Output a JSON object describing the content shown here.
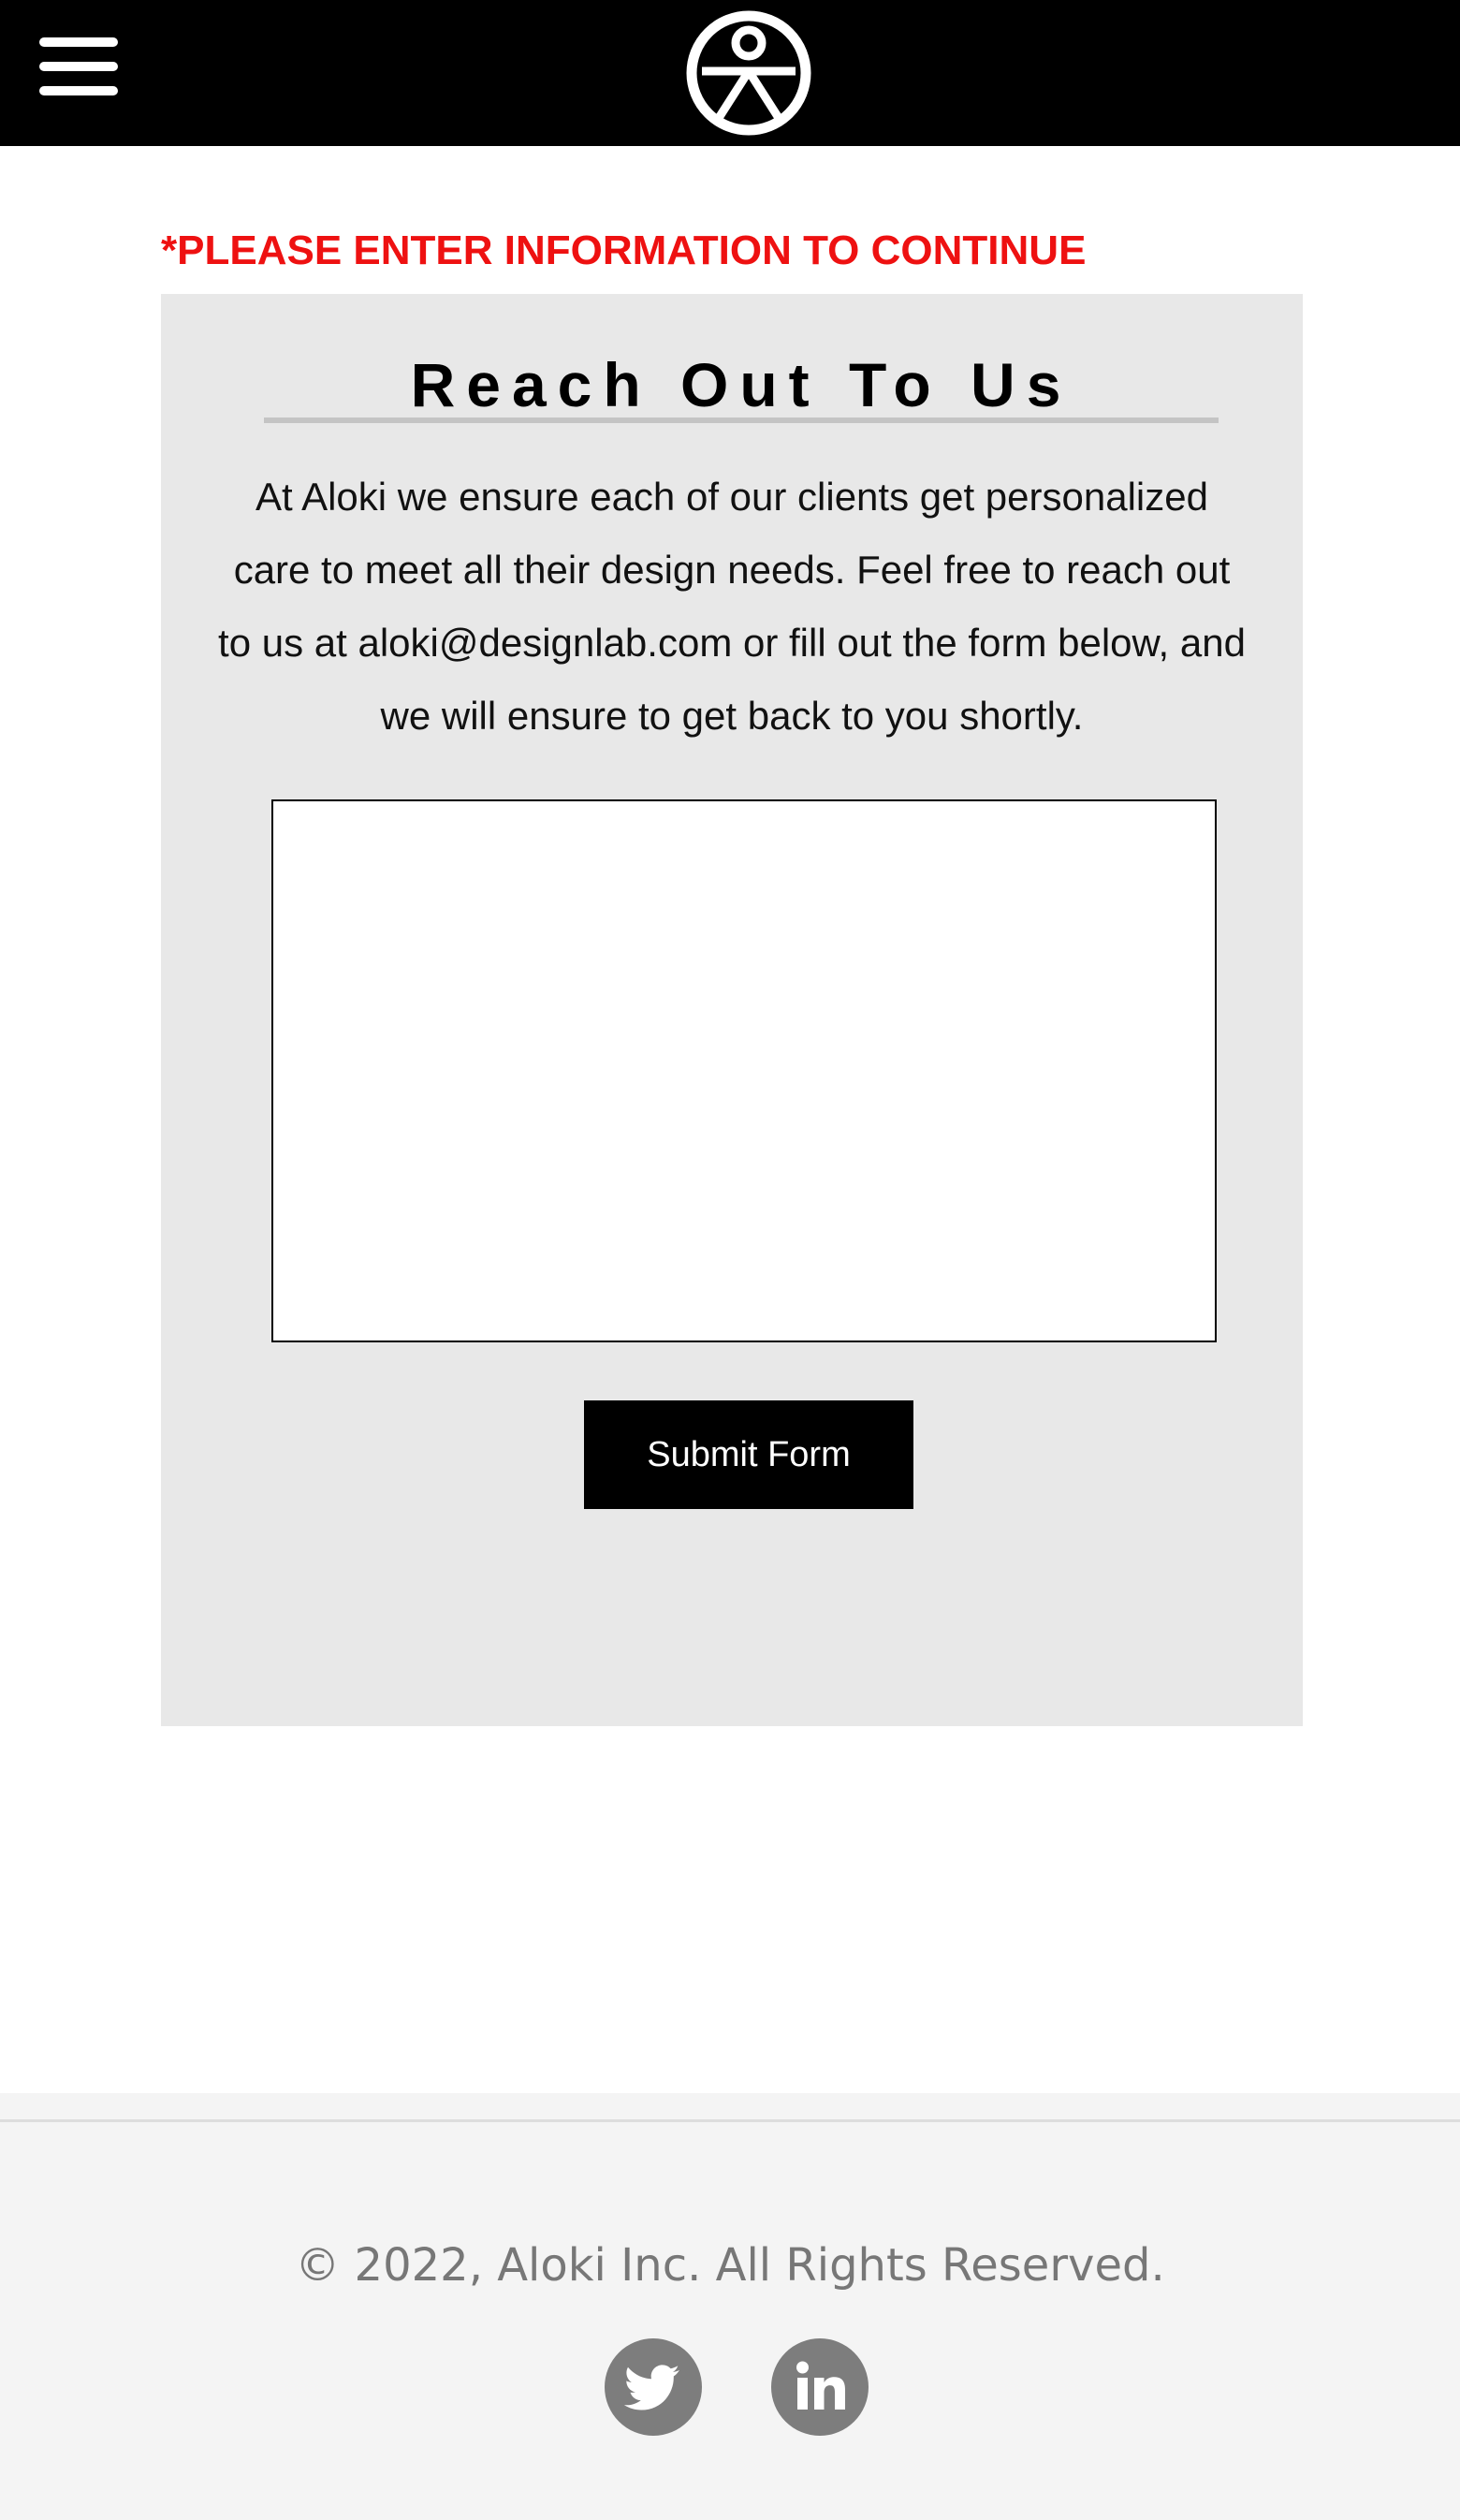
{
  "header": {
    "menu_icon": "hamburger-menu-icon",
    "logo_icon": "aloki-person-logo-icon"
  },
  "warning": {
    "text": "*PLEASE ENTER INFORMATION TO CONTINUE",
    "color": "#ee1111"
  },
  "contact": {
    "title": "Reach Out To Us",
    "intro": "At Aloki we ensure each of our clients get personalized care to meet all their design needs. Feel free to reach out to us at aloki@designlab.com or fill out the form below, and we will ensure to get back to you shortly.",
    "message_value": "",
    "submit_label": "Submit Form"
  },
  "footer": {
    "copyright": "© 2022, Aloki Inc. All Rights Reserved.",
    "social": [
      {
        "icon": "twitter-icon"
      },
      {
        "icon": "linkedin-icon"
      }
    ]
  },
  "colors": {
    "header_bg": "#000000",
    "card_bg": "#e8e8e8",
    "footer_bg": "#f4f4f4",
    "social_icon": "#7d7d7d"
  }
}
